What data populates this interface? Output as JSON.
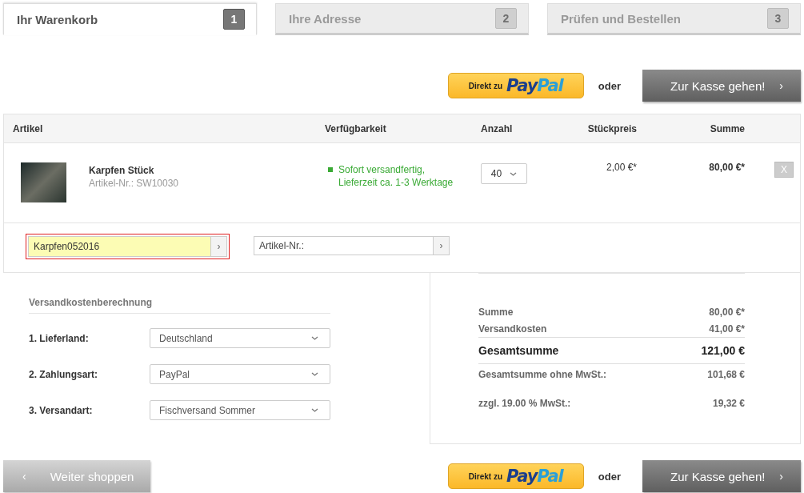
{
  "steps": [
    {
      "label": "Ihr Warenkorb",
      "number": "1",
      "selected": true
    },
    {
      "label": "Ihre Adresse",
      "number": "2",
      "selected": false
    },
    {
      "label": "Prüfen und Bestellen",
      "number": "3",
      "selected": false
    }
  ],
  "top_actions": {
    "paypal_button": {
      "prefix": "Direkt zu",
      "logo_parts": [
        "Pay",
        "Pal"
      ]
    },
    "or_label": "oder",
    "checkout_button": {
      "label": "Zur Kasse gehen!",
      "arrow": "›"
    }
  },
  "table": {
    "columns": [
      "Artikel",
      "Verfügbarkeit",
      "Anzahl",
      "Stückpreis",
      "Summe"
    ],
    "rows": [
      {
        "name": "Karpfen Stück",
        "sku": "Artikel-Nr.: SW10030",
        "availability": "Sofort versandfertig, Lieferzeit ca. 1-3 Werktage",
        "in_stock": true,
        "quantity": "40",
        "unit_price": "2,00 €*",
        "total": "80,00 €*",
        "remove": "X"
      }
    ]
  },
  "voucher_field": {
    "value": "Karpfen052016",
    "invalid": true,
    "arrow": "›"
  },
  "sku_field": {
    "placeholder": "Artikel-Nr.:",
    "arrow": "›"
  },
  "shipping": {
    "title": "Versandkostenberechnung",
    "fields": [
      {
        "label": "1. Lieferland:",
        "value": "Deutschland"
      },
      {
        "label": "2. Zahlungsart:",
        "value": "PayPal"
      },
      {
        "label": "3. Versandart:",
        "value": "Fischversand Sommer"
      }
    ]
  },
  "summary": [
    {
      "kind": "normal",
      "label": "Summe",
      "value": "80,00 €*"
    },
    {
      "kind": "normal",
      "label": "Versandkosten",
      "value": "41,00 €*"
    },
    {
      "kind": "total",
      "label": "Gesamtsumme",
      "value": "121,00 €"
    },
    {
      "kind": "net",
      "label": "Gesamtsumme ohne MwSt.:",
      "value": "101,68 €"
    },
    {
      "kind": "tax",
      "label": "zzgl. 19.00 % MwSt.:",
      "value": "19,32 €"
    }
  ],
  "continue_button": {
    "arrow": "‹",
    "label": "Weiter shoppen"
  },
  "bottom_actions": {
    "paypal_button": {
      "prefix": "Direkt zu",
      "logo_parts": [
        "Pay",
        "Pal"
      ]
    },
    "or_label": "oder",
    "checkout_button": {
      "label": "Zur Kasse gehen!",
      "arrow": "›"
    }
  }
}
